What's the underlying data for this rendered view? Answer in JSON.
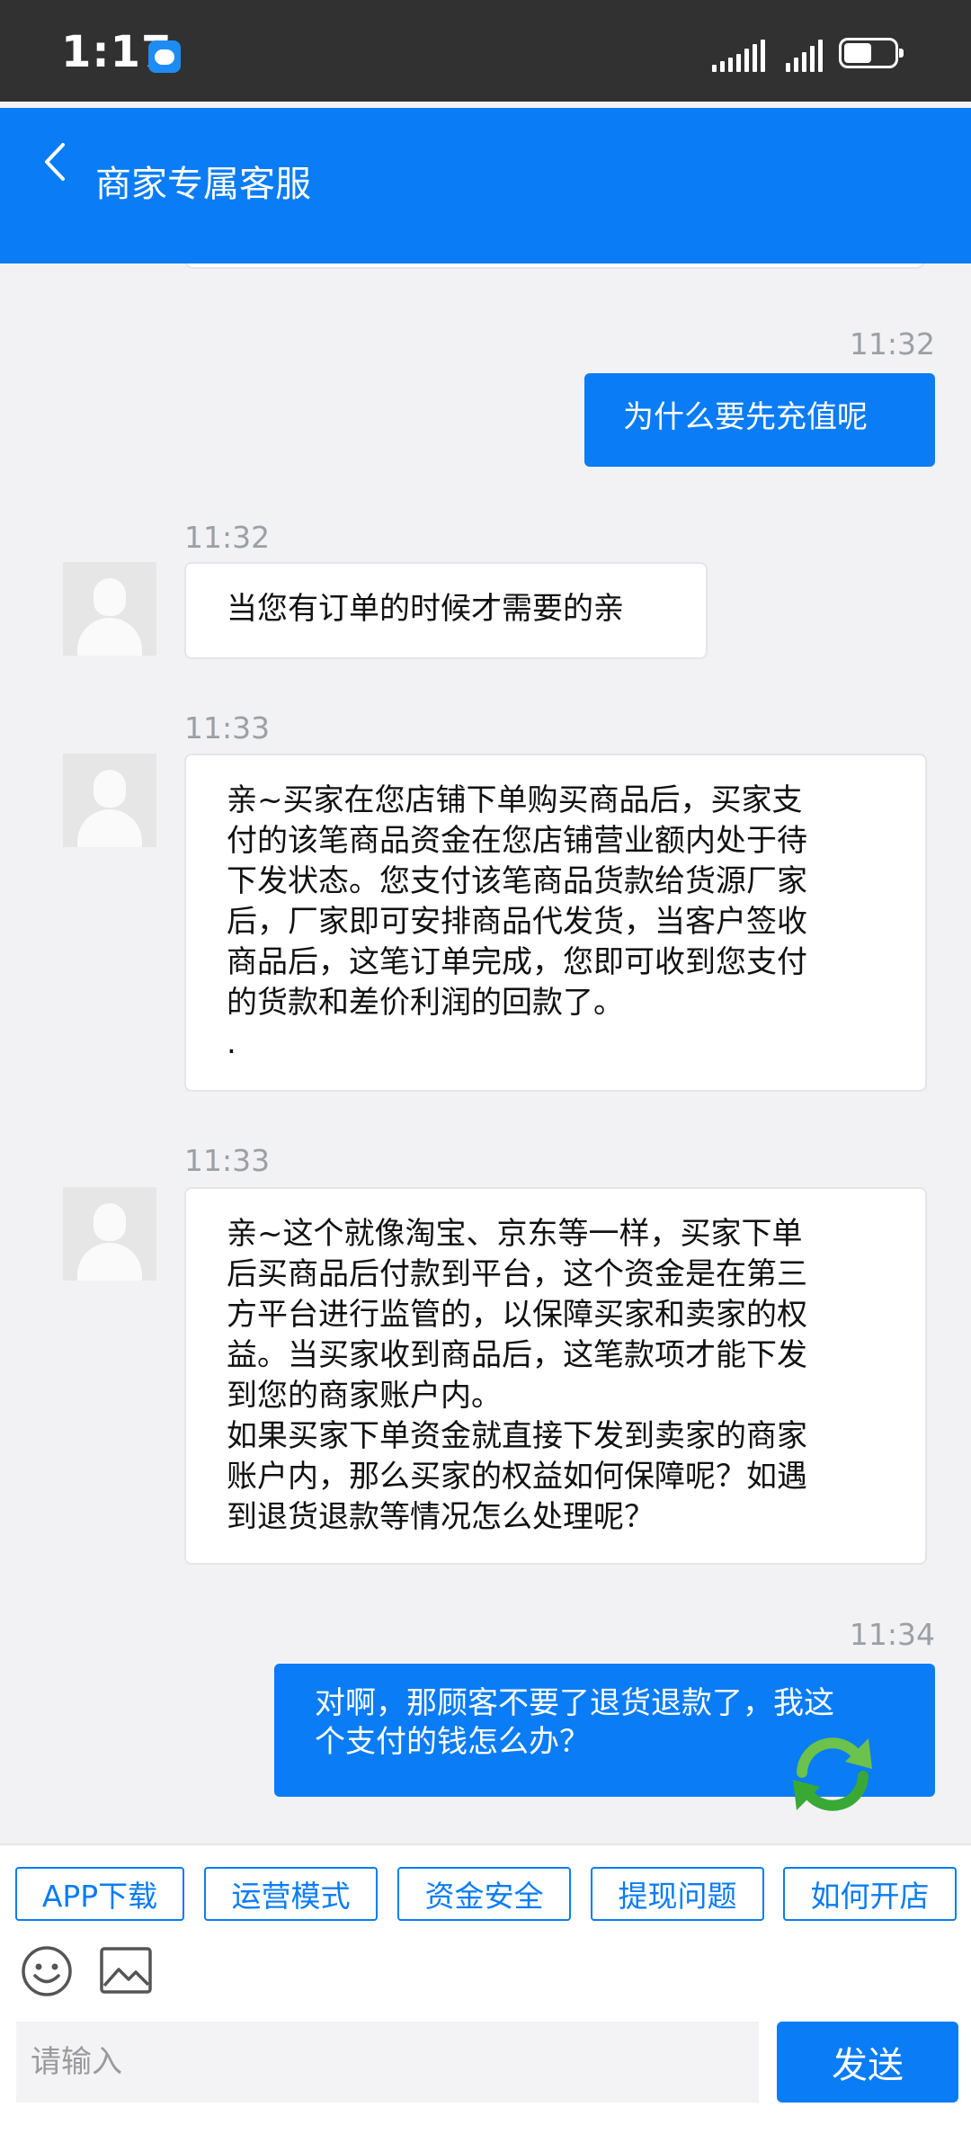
{
  "status_bar": {
    "time": "1:17"
  },
  "header": {
    "title": "商家专属客服"
  },
  "messages": [
    {
      "side": "right",
      "time": "11:32",
      "text": "为什么要先充值呢"
    },
    {
      "side": "left",
      "time": "11:32",
      "text": "当您有订单的时候才需要的亲"
    },
    {
      "side": "left",
      "time": "11:33",
      "text": "亲~买家在您店铺下单购买商品后，买家支\n付的该笔商品资金在您店铺营业额内处于待\n下发状态。您支付该笔商品货款给货源厂家\n后，厂家即可安排商品代发货，当客户签收\n商品后，这笔订单完成，您即可收到您支付\n的货款和差价利润的回款了。\n."
    },
    {
      "side": "left",
      "time": "11:33",
      "text": "亲~这个就像淘宝、京东等一样，买家下单\n后买商品后付款到平台，这个资金是在第三\n方平台进行监管的，以保障买家和卖家的权\n益。当买家收到商品后，这笔款项才能下发\n到您的商家账户内。\n如果买家下单资金就直接下发到卖家的商家\n账户内，那么买家的权益如何保障呢？如遇\n到退货退款等情况怎么处理呢？"
    },
    {
      "side": "right",
      "time": "11:34",
      "text": "对啊，那顾客不要了退货退款了，我这\n个支付的钱怎么办？"
    }
  ],
  "quick_buttons": [
    "APP下载",
    "运营模式",
    "资金安全",
    "提现问题",
    "如何开店"
  ],
  "input": {
    "placeholder": "请输入",
    "value": ""
  },
  "send_label": "发送",
  "colors": {
    "brand": "#0a7cf5",
    "status_bar": "#313131",
    "background": "#f2f2f4"
  }
}
